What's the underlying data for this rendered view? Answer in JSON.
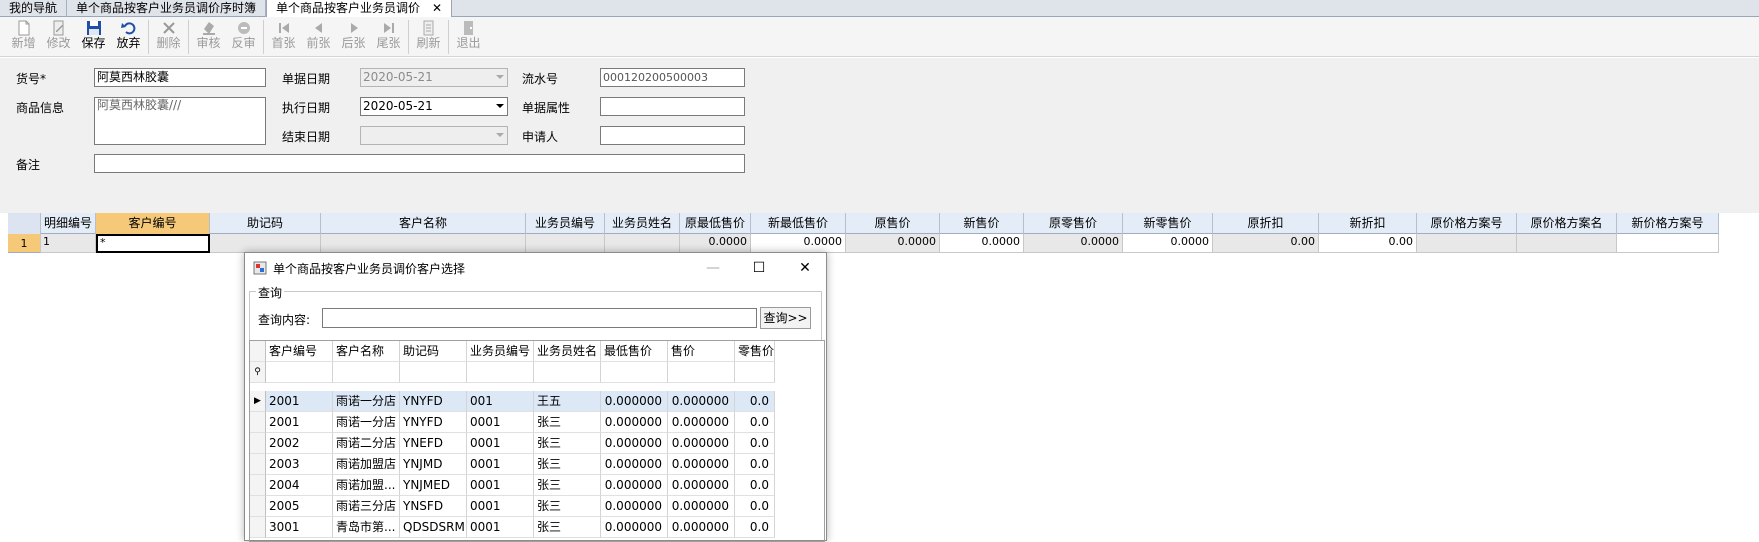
{
  "tabs": [
    {
      "label": "我的导航",
      "active": false
    },
    {
      "label": "单个商品按客户业务员调价序时簿",
      "active": false
    },
    {
      "label": "单个商品按客户业务员调价",
      "active": true
    }
  ],
  "tab_close": "✕",
  "toolbar": [
    {
      "id": "new",
      "label": "新增",
      "icon": "new-doc-icon",
      "enabled": false
    },
    {
      "id": "edit",
      "label": "修改",
      "icon": "edit-icon",
      "enabled": false
    },
    {
      "id": "save",
      "label": "保存",
      "icon": "save-icon",
      "enabled": true
    },
    {
      "id": "discard",
      "label": "放弃",
      "icon": "undo-icon",
      "enabled": true
    },
    {
      "id": "delete",
      "label": "删除",
      "icon": "delete-icon",
      "enabled": false
    },
    {
      "id": "audit",
      "label": "审核",
      "icon": "audit-icon",
      "enabled": false
    },
    {
      "id": "unaudit",
      "label": "反审",
      "icon": "unaudit-icon",
      "enabled": false
    },
    {
      "id": "first",
      "label": "首张",
      "icon": "first-icon",
      "enabled": false
    },
    {
      "id": "prev",
      "label": "前张",
      "icon": "prev-icon",
      "enabled": false
    },
    {
      "id": "next",
      "label": "后张",
      "icon": "next-icon",
      "enabled": false
    },
    {
      "id": "last",
      "label": "尾张",
      "icon": "last-icon",
      "enabled": false
    },
    {
      "id": "refresh",
      "label": "刷新",
      "icon": "refresh-icon",
      "enabled": false
    },
    {
      "id": "exit",
      "label": "退出",
      "icon": "exit-icon",
      "enabled": false
    }
  ],
  "form": {
    "goods_no_label": "货号*",
    "goods_no_value": "阿莫西林胶囊",
    "goods_info_label": "商品信息",
    "goods_info_value": "阿莫西林胶囊///",
    "doc_date_label": "单据日期",
    "doc_date_value": "2020-05-21",
    "exec_date_label": "执行日期",
    "exec_date_value": "2020-05-21",
    "end_date_label": "结束日期",
    "end_date_value": "",
    "serial_label": "流水号",
    "serial_value": "000120200500003",
    "doc_attr_label": "单据属性",
    "doc_attr_value": "",
    "applicant_label": "申请人",
    "applicant_value": "",
    "remark_label": "备注",
    "remark_value": ""
  },
  "grid": {
    "columns": [
      "明细编号",
      "客户编号",
      "助记码",
      "客户名称",
      "业务员编号",
      "业务员姓名",
      "原最低售价",
      "新最低售价",
      "原售价",
      "新售价",
      "原零售价",
      "新零售价",
      "原折扣",
      "新折扣",
      "原价格方案号",
      "原价格方案名",
      "新价格方案号"
    ],
    "row": {
      "row_no": "1",
      "cells": [
        "1",
        "*",
        "",
        "",
        "",
        "",
        "0.0000",
        "0.0000",
        "0.0000",
        "0.0000",
        "0.0000",
        "0.0000",
        "0.00",
        "0.00",
        "",
        "",
        ""
      ]
    }
  },
  "dialog": {
    "title": "单个商品按客户业务员调价客户选择",
    "minimize": "—",
    "maximize": "☐",
    "close": "✕",
    "group_label": "查询",
    "query_label": "查询内容:",
    "query_value": "",
    "query_button": "查询>>",
    "columns": [
      "客户编号",
      "客户名称",
      "助记码",
      "业务员编号",
      "业务员姓名",
      "最低售价",
      "售价",
      "零售价"
    ],
    "filter_icon": "filter-icon",
    "rows": [
      [
        "2001",
        "雨诺一分店",
        "YNYFD",
        "001",
        "王五",
        "0.000000",
        "0.000000",
        "0.0"
      ],
      [
        "2001",
        "雨诺一分店",
        "YNYFD",
        "0001",
        "张三",
        "0.000000",
        "0.000000",
        "0.0"
      ],
      [
        "2002",
        "雨诺二分店",
        "YNEFD",
        "0001",
        "张三",
        "0.000000",
        "0.000000",
        "0.0"
      ],
      [
        "2003",
        "雨诺加盟店",
        "YNJMD",
        "0001",
        "张三",
        "0.000000",
        "0.000000",
        "0.0"
      ],
      [
        "2004",
        "雨诺加盟...",
        "YNJMED",
        "0001",
        "张三",
        "0.000000",
        "0.000000",
        "0.0"
      ],
      [
        "2005",
        "雨诺三分店",
        "YNSFD",
        "0001",
        "张三",
        "0.000000",
        "0.000000",
        "0.0"
      ],
      [
        "3001",
        "青岛市第...",
        "QDSDSRM...",
        "0001",
        "张三",
        "0.000000",
        "0.000000",
        "0.0"
      ]
    ]
  }
}
